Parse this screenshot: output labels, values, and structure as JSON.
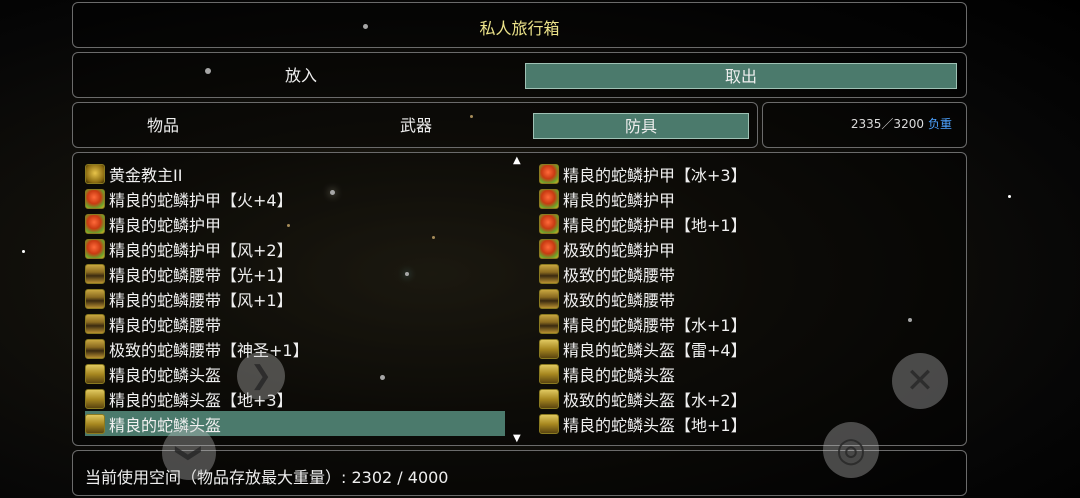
{
  "window": {
    "title": "私人旅行箱"
  },
  "mode": {
    "put_label": "放入",
    "take_label": "取出"
  },
  "tabs": {
    "items": "物品",
    "weapons": "武器",
    "armor": "防具"
  },
  "weight": {
    "value": "2335／3200",
    "label": "负重"
  },
  "list": {
    "left": [
      {
        "icon": "gold-relic-icon",
        "name": "黄金教主II"
      },
      {
        "icon": "armor-icon",
        "name": "精良的蛇鳞护甲【火+4】"
      },
      {
        "icon": "armor-icon",
        "name": "精良的蛇鳞护甲"
      },
      {
        "icon": "armor-icon",
        "name": "精良的蛇鳞护甲【风+2】"
      },
      {
        "icon": "belt-icon",
        "name": "精良的蛇鳞腰带【光+1】"
      },
      {
        "icon": "belt-icon",
        "name": "精良的蛇鳞腰带【风+1】"
      },
      {
        "icon": "belt-icon",
        "name": "精良的蛇鳞腰带"
      },
      {
        "icon": "belt-icon",
        "name": "极致的蛇鳞腰带【神圣+1】"
      },
      {
        "icon": "helmet-icon",
        "name": "精良的蛇鳞头盔"
      },
      {
        "icon": "helmet-icon",
        "name": "精良的蛇鳞头盔【地+3】"
      },
      {
        "icon": "helmet-icon",
        "name": "精良的蛇鳞头盔"
      }
    ],
    "right": [
      {
        "icon": "armor-icon",
        "name": "精良的蛇鳞护甲【冰+3】"
      },
      {
        "icon": "armor-icon",
        "name": "精良的蛇鳞护甲"
      },
      {
        "icon": "armor-icon",
        "name": "精良的蛇鳞护甲【地+1】"
      },
      {
        "icon": "armor-icon",
        "name": "极致的蛇鳞护甲"
      },
      {
        "icon": "belt-icon",
        "name": "极致的蛇鳞腰带"
      },
      {
        "icon": "belt-icon",
        "name": "极致的蛇鳞腰带"
      },
      {
        "icon": "belt-icon",
        "name": "精良的蛇鳞腰带【水+1】"
      },
      {
        "icon": "helmet-icon",
        "name": "精良的蛇鳞头盔【雷+4】"
      },
      {
        "icon": "helmet-icon",
        "name": "精良的蛇鳞头盔"
      },
      {
        "icon": "helmet-icon",
        "name": "极致的蛇鳞头盔【水+2】"
      },
      {
        "icon": "helmet-icon",
        "name": "精良的蛇鳞头盔【地+1】"
      }
    ],
    "scroll_up": "▲",
    "scroll_down": "▼"
  },
  "footer": {
    "usage": "当前使用空间（物品存放最大重量）: 2302 / 4000"
  },
  "controls": {
    "close": "✕",
    "next": "❯",
    "down": "❯",
    "confirm": "◎"
  }
}
